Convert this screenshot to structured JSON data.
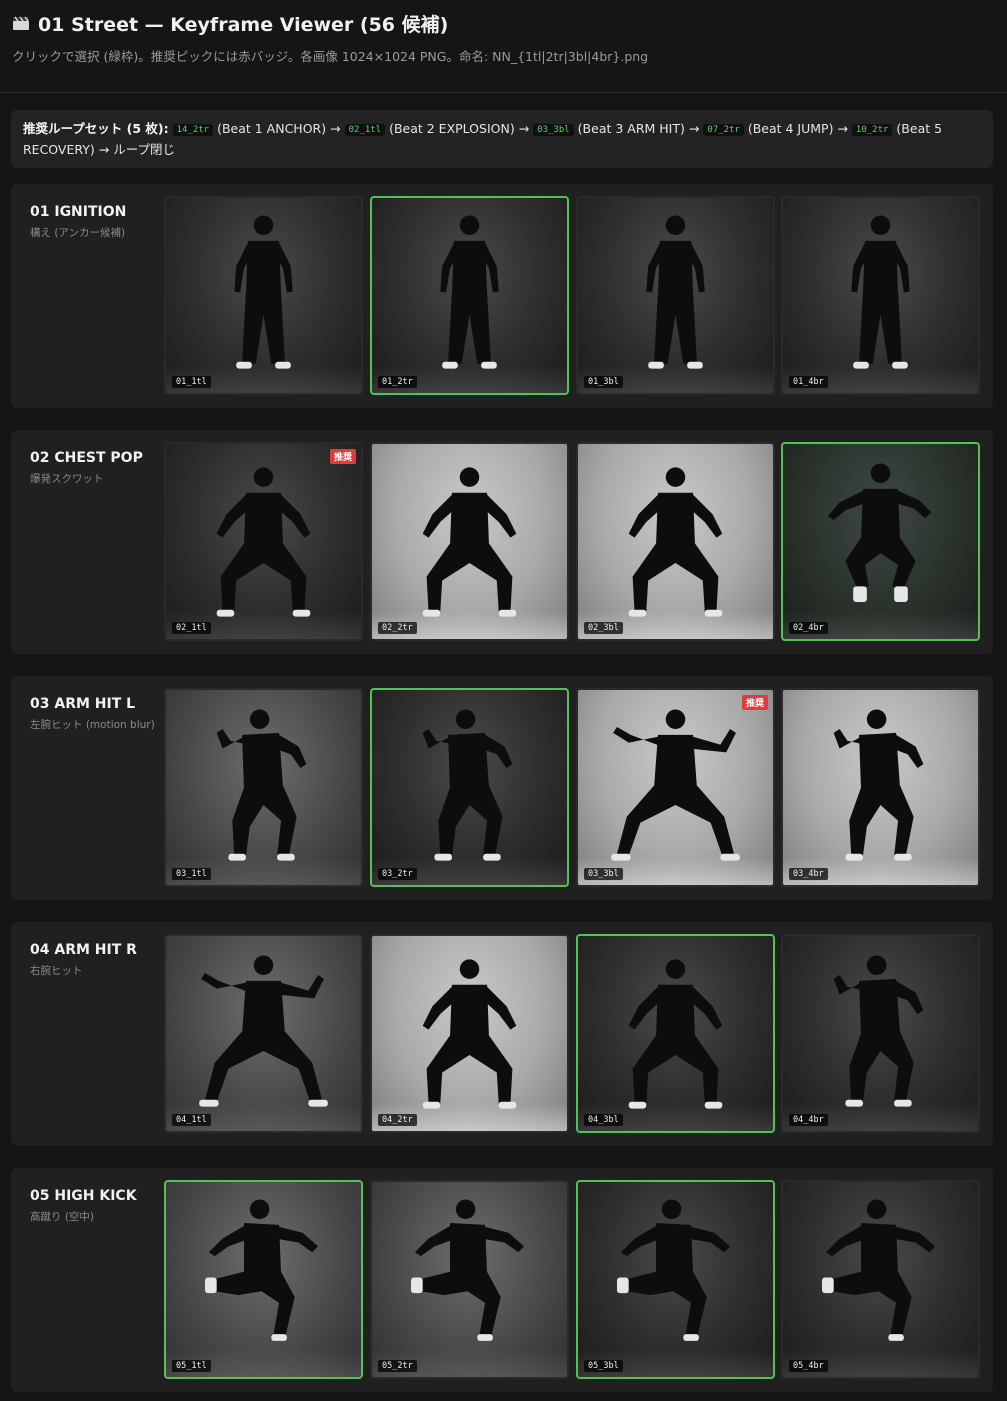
{
  "header": {
    "title": "01 Street — Keyframe Viewer (56 候補)",
    "subtitle": "クリックで選択 (緑枠)。推奨ピックには赤バッジ。各画像 1024×1024 PNG。命名: NN_{1tl|2tr|3bl|4br}.png"
  },
  "recommended": {
    "lead": "推奨ループセット (5 枚):",
    "items": [
      {
        "code": "14_2tr",
        "label": "(Beat 1 ANCHOR)"
      },
      {
        "code": "02_1tl",
        "label": "(Beat 2 EXPLOSION)"
      },
      {
        "code": "03_3bl",
        "label": "(Beat 3 ARM HIT)"
      },
      {
        "code": "07_2tr",
        "label": "(Beat 4 JUMP)"
      },
      {
        "code": "10_2tr",
        "label": "(Beat 5"
      }
    ],
    "tail": "RECOVERY) → ループ閉じ",
    "arrow": "→"
  },
  "colors": {
    "selected_border": "#52c15a",
    "badge": "#e23b3b",
    "code_text": "#5fd06a"
  },
  "groups": [
    {
      "title": "01 IGNITION",
      "subtitle": "構え (アンカー候補)",
      "thumbs": [
        {
          "label": "01_1tl",
          "selected": false,
          "badge": "",
          "tone": "dark",
          "pose": "stand"
        },
        {
          "label": "01_2tr",
          "selected": true,
          "badge": "",
          "tone": "dark",
          "pose": "stand"
        },
        {
          "label": "01_3bl",
          "selected": false,
          "badge": "",
          "tone": "dark",
          "pose": "stand"
        },
        {
          "label": "01_4br",
          "selected": false,
          "badge": "",
          "tone": "dark",
          "pose": "stand"
        }
      ]
    },
    {
      "title": "02 CHEST POP",
      "subtitle": "爆発スクワット",
      "thumbs": [
        {
          "label": "02_1tl",
          "selected": false,
          "badge": "推奨",
          "tone": "dark",
          "pose": "squat"
        },
        {
          "label": "02_2tr",
          "selected": false,
          "badge": "",
          "tone": "light",
          "pose": "squat"
        },
        {
          "label": "02_3bl",
          "selected": false,
          "badge": "",
          "tone": "light",
          "pose": "squat"
        },
        {
          "label": "02_4br",
          "selected": true,
          "badge": "",
          "tone": "green",
          "pose": "jump"
        }
      ]
    },
    {
      "title": "03 ARM HIT L",
      "subtitle": "左腕ヒット (motion blur)",
      "thumbs": [
        {
          "label": "03_1tl",
          "selected": false,
          "badge": "",
          "tone": "mid",
          "pose": "hit"
        },
        {
          "label": "03_2tr",
          "selected": true,
          "badge": "",
          "tone": "dark",
          "pose": "hit"
        },
        {
          "label": "03_3bl",
          "selected": false,
          "badge": "推奨",
          "tone": "light",
          "pose": "wide"
        },
        {
          "label": "03_4br",
          "selected": false,
          "badge": "",
          "tone": "light",
          "pose": "hit"
        }
      ]
    },
    {
      "title": "04 ARM HIT R",
      "subtitle": "右腕ヒット",
      "thumbs": [
        {
          "label": "04_1tl",
          "selected": false,
          "badge": "",
          "tone": "mid",
          "pose": "wide"
        },
        {
          "label": "04_2tr",
          "selected": false,
          "badge": "",
          "tone": "light",
          "pose": "squat"
        },
        {
          "label": "04_3bl",
          "selected": true,
          "badge": "",
          "tone": "dark",
          "pose": "squat"
        },
        {
          "label": "04_4br",
          "selected": false,
          "badge": "",
          "tone": "dark",
          "pose": "hit"
        }
      ]
    },
    {
      "title": "05 HIGH KICK",
      "subtitle": "高蹴り (空中)",
      "thumbs": [
        {
          "label": "05_1tl",
          "selected": true,
          "badge": "",
          "tone": "mid",
          "pose": "kick"
        },
        {
          "label": "05_2tr",
          "selected": false,
          "badge": "",
          "tone": "mid",
          "pose": "kick"
        },
        {
          "label": "05_3bl",
          "selected": true,
          "badge": "",
          "tone": "dark",
          "pose": "kick"
        },
        {
          "label": "05_4br",
          "selected": false,
          "badge": "",
          "tone": "dark",
          "pose": "kick"
        }
      ]
    }
  ]
}
